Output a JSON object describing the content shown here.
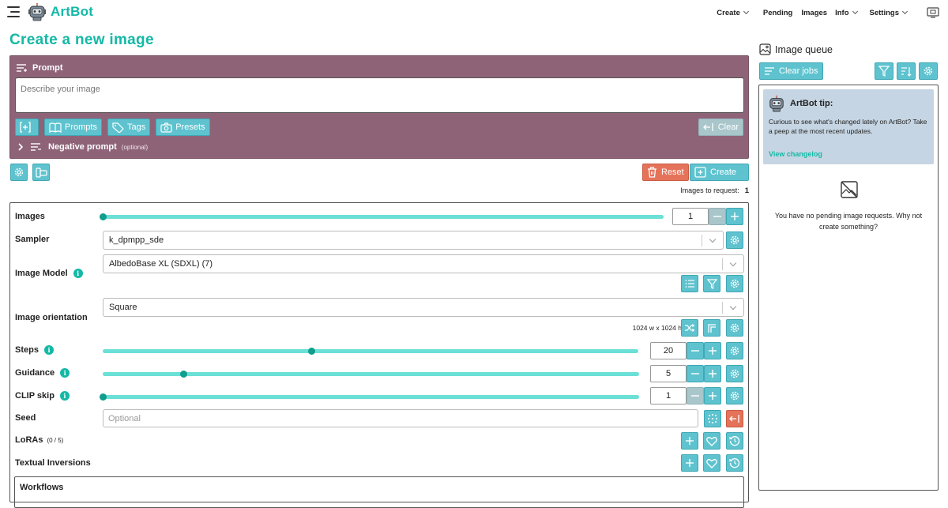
{
  "app": {
    "brand": "ArtBot"
  },
  "nav": {
    "create": "Create",
    "pending": "Pending",
    "images": "Images",
    "info": "Info",
    "settings": "Settings"
  },
  "page": {
    "title": "Create a new image"
  },
  "prompt": {
    "label": "Prompt",
    "placeholder": "Describe your image",
    "buttons": {
      "prompts": "Prompts",
      "tags": "Tags",
      "presets": "Presets",
      "clear": "Clear"
    },
    "negative_label": "Negative prompt",
    "negative_optional": "(optional)"
  },
  "actions": {
    "reset": "Reset",
    "create": "Create",
    "images_to_request_label": "Images to request:",
    "images_to_request_value": "1"
  },
  "settings": {
    "images": {
      "label": "Images",
      "value": "1",
      "slider_fraction": 0.0
    },
    "sampler": {
      "label": "Sampler",
      "value": "k_dpmpp_sde"
    },
    "model": {
      "label": "Image Model",
      "value": "AlbedoBase XL (SDXL) (7)"
    },
    "orientation": {
      "label": "Image orientation",
      "value": "Square",
      "dimensions": "1024 w x 1024 h"
    },
    "steps": {
      "label": "Steps",
      "value": "20",
      "slider_fraction": 0.39
    },
    "guidance": {
      "label": "Guidance",
      "value": "5",
      "slider_fraction": 0.15
    },
    "clip_skip": {
      "label": "CLIP skip",
      "value": "1",
      "slider_fraction": 0.0
    },
    "seed": {
      "label": "Seed",
      "placeholder": "Optional"
    },
    "loras": {
      "label": "LoRAs",
      "count": "(0 / 5)"
    },
    "textual_inversions": {
      "label": "Textual Inversions"
    },
    "workflows": {
      "label": "Workflows"
    }
  },
  "queue": {
    "title": "Image queue",
    "clear_jobs": "Clear jobs",
    "tip": {
      "title": "ArtBot tip:",
      "body": "Curious to see what's changed lately on ArtBot? Take a peep at the most recent updates.",
      "link": "View changelog"
    },
    "empty_message": "You have no pending image requests. Why not create something?"
  },
  "colors": {
    "accent": "#14b8a6",
    "button": "#5ec3cf",
    "prompt_panel": "#8e6378",
    "danger": "#e4735a",
    "tip_bg": "#c6d5e3"
  }
}
